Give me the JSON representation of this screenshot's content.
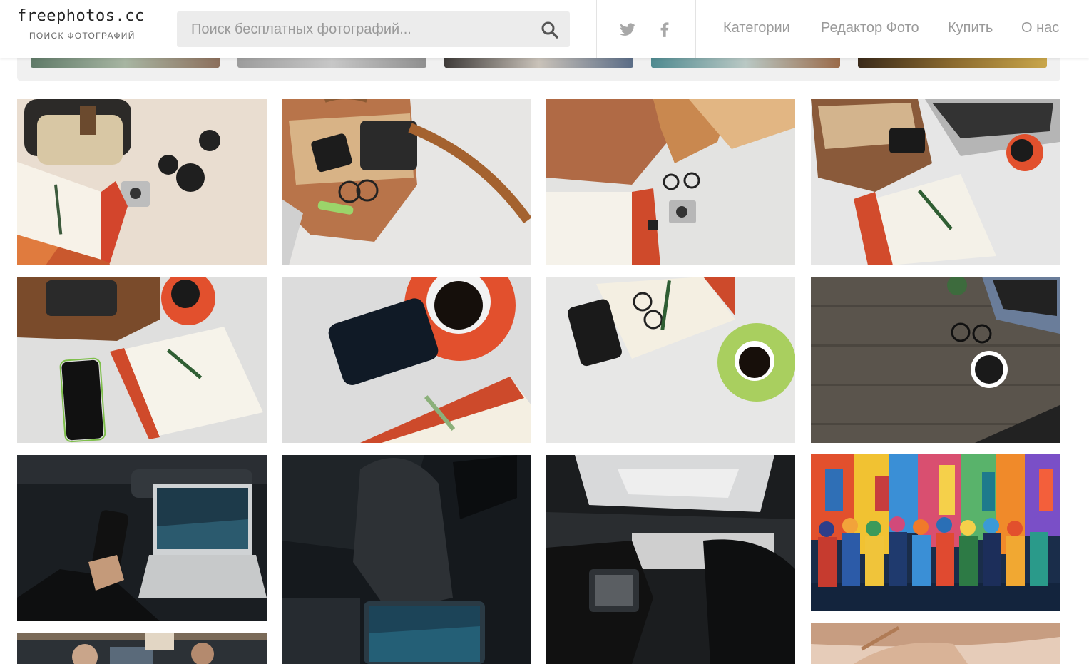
{
  "header": {
    "logo_main": "freephotos.cc",
    "logo_sub": "поиск фотографий",
    "search_placeholder": "Поиск бесплатных фотографий...",
    "social": [
      "twitter-icon",
      "facebook-icon"
    ],
    "nav": [
      "Категории",
      "Редактор Фото",
      "Купить",
      "О нас"
    ]
  },
  "colors": {
    "accent_orange": "#e2502d",
    "header_text": "#9a9a9a",
    "search_bg": "#ececec"
  },
  "photos": [
    {
      "subject": "bag-sunglasses-notebook-camera"
    },
    {
      "subject": "leather-purse-phone-glasses"
    },
    {
      "subject": "brown-bag-notebook-glasses-camera"
    },
    {
      "subject": "purse-laptop-coffee-notebook"
    },
    {
      "subject": "purse-coffee-phone-notebook"
    },
    {
      "subject": "coffee-phone-notebook-pen"
    },
    {
      "subject": "phone-notebook-glasses-green-coffee"
    },
    {
      "subject": "wood-desk-laptop-glasses-coffee"
    },
    {
      "subject": "car-interior-laptop-phone"
    },
    {
      "subject": "car-seat-laptop"
    },
    {
      "subject": "car-sunroof-interior"
    },
    {
      "subject": "colorful-people-painting"
    },
    {
      "subject": "office-people-partial"
    },
    {
      "subject": "hands-partial"
    }
  ]
}
